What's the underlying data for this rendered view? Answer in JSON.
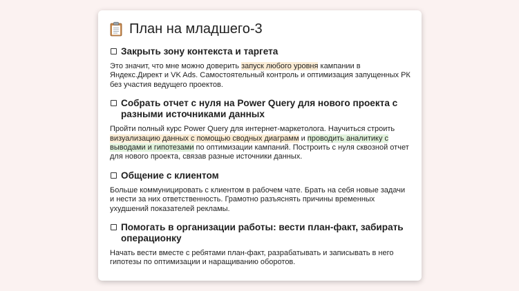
{
  "page": {
    "title": "План на младшего-3",
    "title_icon": "clipboard-icon"
  },
  "sections": [
    {
      "heading": "Закрыть зону контекста и таргета",
      "parts": [
        {
          "text": "Это значит, что мне можно доверить "
        },
        {
          "text": "запуск любого уровня",
          "hl": "#fbecd4"
        },
        {
          "text": " кампании в Яндекс.Директ и VK Ads. Самостоятельный контроль и оптимизация запущенных РК без участия ведущего проектов."
        }
      ]
    },
    {
      "heading": "Собрать отчет с нуля на Power Query для нового проекта с разными источниками данных",
      "parts": [
        {
          "text": "Пройти полный курс Power Query для интернет-маркетолога. Научиться строить "
        },
        {
          "text": "визуализацию данных с помощью сводных диаграмм",
          "hl": "#fbecd4"
        },
        {
          "text": " и "
        },
        {
          "text": "проводить аналитику с выводами и гипотезами",
          "hl": "#e1f2dc"
        },
        {
          "text": " по оптимизации кампаний. Построить с нуля сквозной отчет для нового проекта, связав разные источники данных."
        }
      ]
    },
    {
      "heading": "Общение с клиентом",
      "parts": [
        {
          "text": "Больше коммуницировать с клиентом в рабочем чате. Брать на себя новые задачи и нести за них ответственность. Грамотно разъяснять причины временных ухудшений показателей рекламы."
        }
      ]
    },
    {
      "heading": "Помогать в организации работы: вести план-факт, забирать операционку",
      "parts": [
        {
          "text": "Начать вести вместе с ребятами план-факт, разрабатывать и записывать в него гипотезы по оптимизации и наращиванию оборотов."
        }
      ]
    }
  ],
  "colors": {
    "background": "#fbf2f1",
    "card": "#ffffff",
    "highlight_orange": "#fbecd4",
    "highlight_green": "#e1f2dc"
  }
}
